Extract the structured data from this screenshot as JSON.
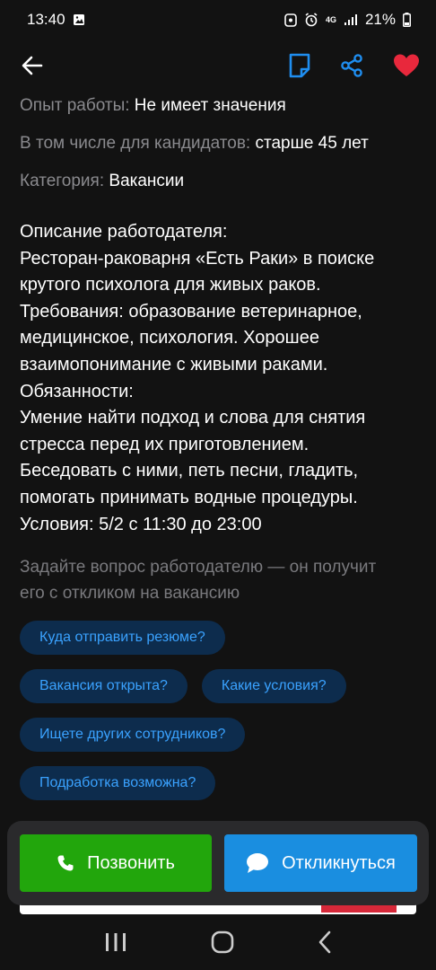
{
  "status_bar": {
    "time": "13:40",
    "battery": "21%",
    "network": "4G"
  },
  "top_bar": {
    "icons": [
      "back-arrow-icon",
      "bookmark-icon",
      "share-icon",
      "heart-icon"
    ],
    "accent_color": "#1f8ef0",
    "heart_color": "#e8283c"
  },
  "meta": [
    {
      "label": "Опыт работы:",
      "value": "Не имеет значения"
    },
    {
      "label": "В том числе для кандидатов:",
      "value": "старше 45 лет"
    },
    {
      "label": "Категория:",
      "value": "Вакансии"
    }
  ],
  "description": [
    "Описание работодателя:",
    "Ресторан-раковарня «Есть Раки» в поиске",
    "крутого психолога для живых раков.",
    "Требования: образование ветеринарное,",
    "медицинское, психология. Хорошее",
    "взаимопонимание с живыми раками.",
    "Обязанности:",
    "Умение найти подход и слова для снятия",
    "стресса перед их приготовлением.",
    "Беседовать с ними, петь песни, гладить,",
    "помогать принимать водные процедуры.",
    "Условия: 5/2 с 11:30 до 23:00"
  ],
  "ask_hint": {
    "line1": "Задайте вопрос работодателю — он получит",
    "line2": "его с откликом на вакансию"
  },
  "quick_questions": [
    "Куда отправить резюме?",
    "Вакансия открыта?",
    "Какие условия?",
    "Ищете других сотрудников?",
    "Подработка возможна?"
  ],
  "actions": {
    "call_label": "Позвонить",
    "reply_label": "Откликнуться",
    "call_color": "#22a60c",
    "reply_color": "#1a8ee0"
  },
  "nav": {
    "icons": [
      "recent-apps-icon",
      "home-icon",
      "back-icon"
    ]
  }
}
